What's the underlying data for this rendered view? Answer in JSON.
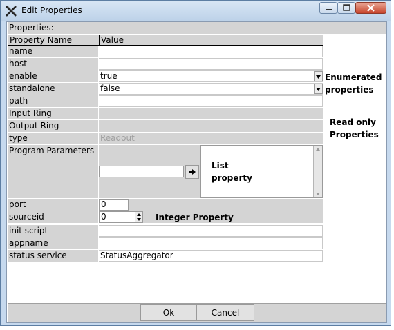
{
  "window": {
    "title": "Edit Properties",
    "app_icon": "x-logo-icon"
  },
  "section_label": "Properties:",
  "table": {
    "headers": [
      "Property Name",
      "Value"
    ]
  },
  "rows": {
    "name": {
      "label": "name",
      "value": ""
    },
    "host": {
      "label": "host",
      "value": ""
    },
    "enable": {
      "label": "enable",
      "value": "true"
    },
    "standalone": {
      "label": "standalone",
      "value": "false"
    },
    "path": {
      "label": "path",
      "value": ""
    },
    "input_ring": {
      "label": "Input Ring",
      "value": ""
    },
    "output_ring": {
      "label": "Output Ring",
      "value": ""
    },
    "type": {
      "label": "type",
      "value": "Readout"
    },
    "program_parameters": {
      "label": "Program Parameters",
      "value": ""
    },
    "port": {
      "label": "port",
      "value": "0"
    },
    "sourceid": {
      "label": "sourceid",
      "value": "0"
    },
    "init_script": {
      "label": "init script",
      "value": ""
    },
    "appname": {
      "label": "appname",
      "value": ""
    },
    "status_service": {
      "label": "status service",
      "value": "StatusAggregator"
    }
  },
  "annotations": {
    "enumerated": [
      "Enumerated",
      "properties"
    ],
    "readonly": [
      "Read only",
      "Properties"
    ],
    "list": [
      "List",
      "property"
    ],
    "integer": "Integer Property"
  },
  "buttons": {
    "ok": "Ok",
    "cancel": "Cancel"
  },
  "colors": {
    "title_bar": "#c6d9ee",
    "label_bg": "#d4d4d4",
    "close_button": "#c7452c"
  }
}
